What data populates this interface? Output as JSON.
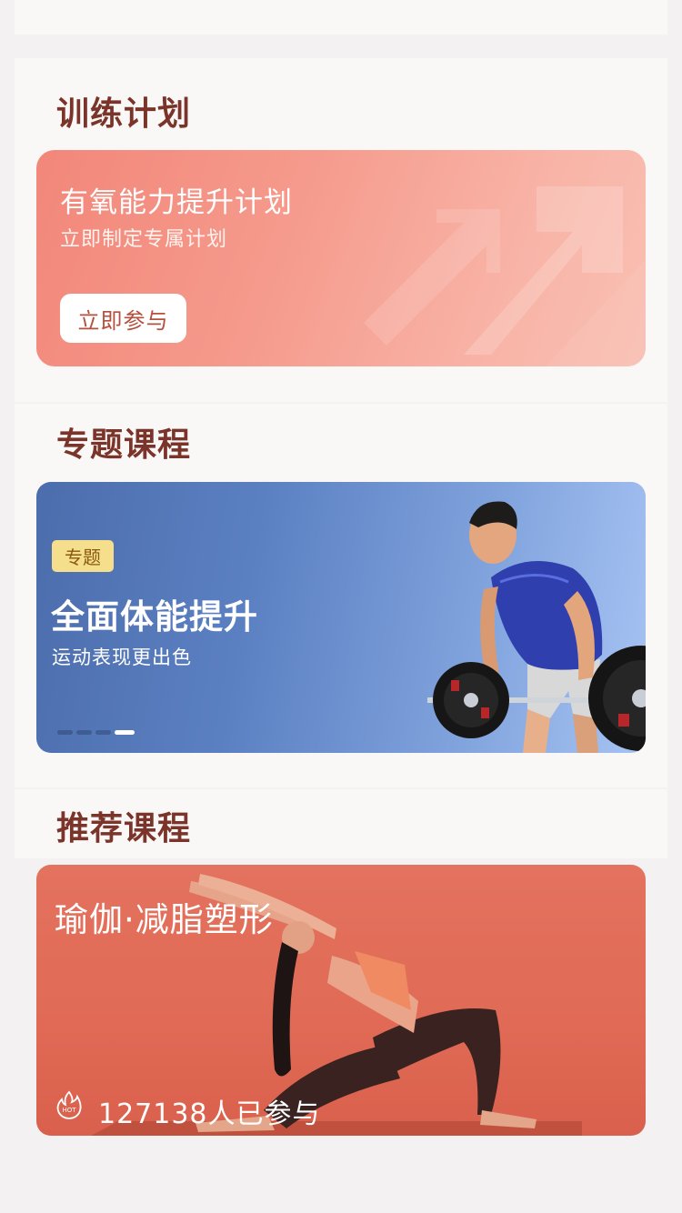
{
  "training_plan": {
    "section_title": "训练计划",
    "card_title": "有氧能力提升计划",
    "card_subtitle": "立即制定专属计划",
    "join_button": "立即参与"
  },
  "topic_courses": {
    "section_title": "专题课程",
    "tag": "专题",
    "title": "全面体能提升",
    "subtitle": "运动表现更出色",
    "carousel": {
      "total": 4,
      "active_index": 3
    }
  },
  "recommended": {
    "section_title": "推荐课程",
    "course_title": "瑜伽·减脂塑形",
    "participants": "127138人已参与",
    "hot_badge": "HOT"
  },
  "colors": {
    "background": "#f3f1f1",
    "section_title": "#7a3429",
    "plan_card": "#f59a8c",
    "topic_card": "#5b80c2",
    "rec_card": "#e06a55",
    "tag_bg": "#f6df8c"
  }
}
